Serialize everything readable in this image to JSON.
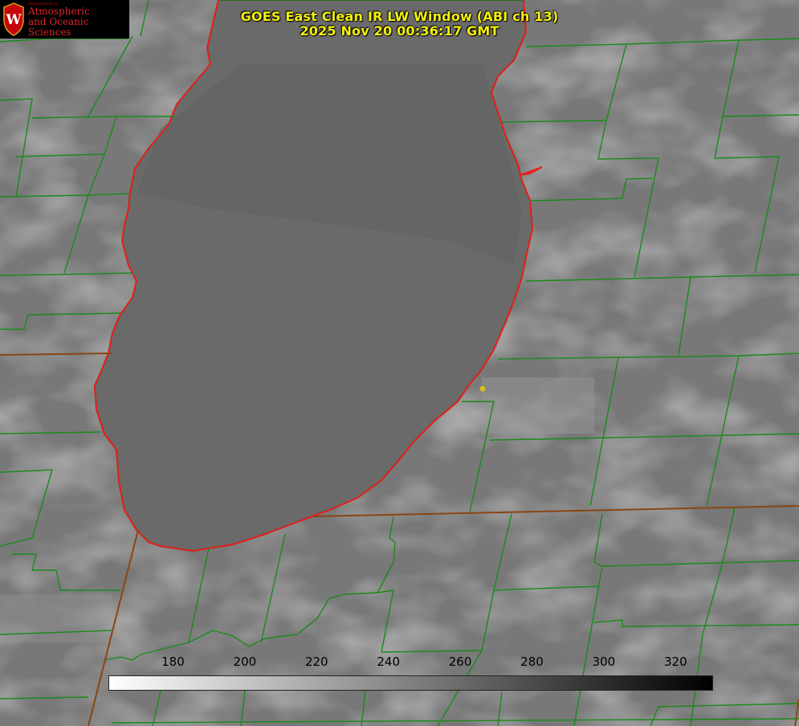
{
  "header": {
    "title_line1": "GOES East Clean IR LW Window (ABI ch 13)",
    "title_line2": "2025 Nov 20 00:36:17 GMT"
  },
  "logo": {
    "department": "Department of",
    "line1": "Atmospheric",
    "line2": "and Oceanic Sciences",
    "icon": "uw-crest-icon"
  },
  "colorbar": {
    "ticks": [
      "180",
      "200",
      "220",
      "240",
      "260",
      "280",
      "300",
      "320"
    ],
    "tick_values": [
      180,
      200,
      220,
      240,
      260,
      280,
      300,
      320
    ],
    "min": 162,
    "max": 330,
    "gradient": [
      "#ffffff",
      "#000000"
    ]
  },
  "colors": {
    "title": "#f4f10a",
    "county_lines": "#1a8a1a",
    "state_lines": "#8b4513",
    "coastline": "#e61e1e",
    "marker": "#d4c41a",
    "logo_text": "#c5050c"
  }
}
